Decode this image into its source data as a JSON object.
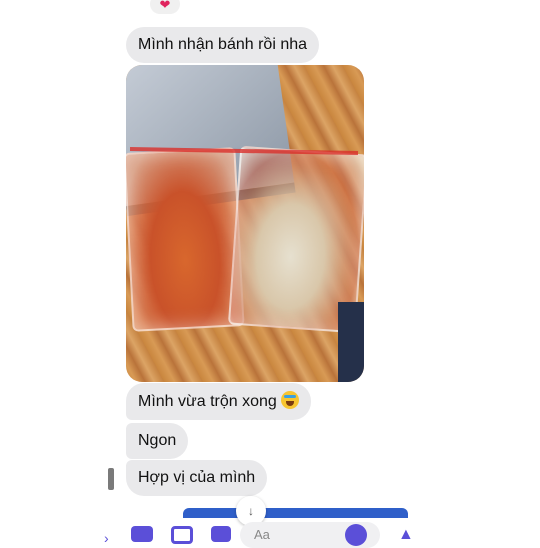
{
  "reaction": {
    "icon": "heart-icon",
    "glyph": "❤"
  },
  "messages": [
    {
      "text": "Mình nhận bánh rồi nha"
    },
    {
      "text": "Mình vừa trộn xong",
      "emoji": "laughing-tears-emoji"
    },
    {
      "text": "Ngon"
    },
    {
      "text": "Hợp vị của mình"
    }
  ],
  "photo": {
    "alt": ""
  },
  "composer": {
    "placeholder": "Aa",
    "icons": [
      "chevron-right-icon",
      "camera-icon",
      "image-icon",
      "mic-icon",
      "emoji-icon",
      "like-icon"
    ],
    "scroll_glyph": "↓"
  },
  "colors": {
    "bubble": "#e9e9eb",
    "accent": "#5b4fd8",
    "reaction": "#e0245e"
  }
}
